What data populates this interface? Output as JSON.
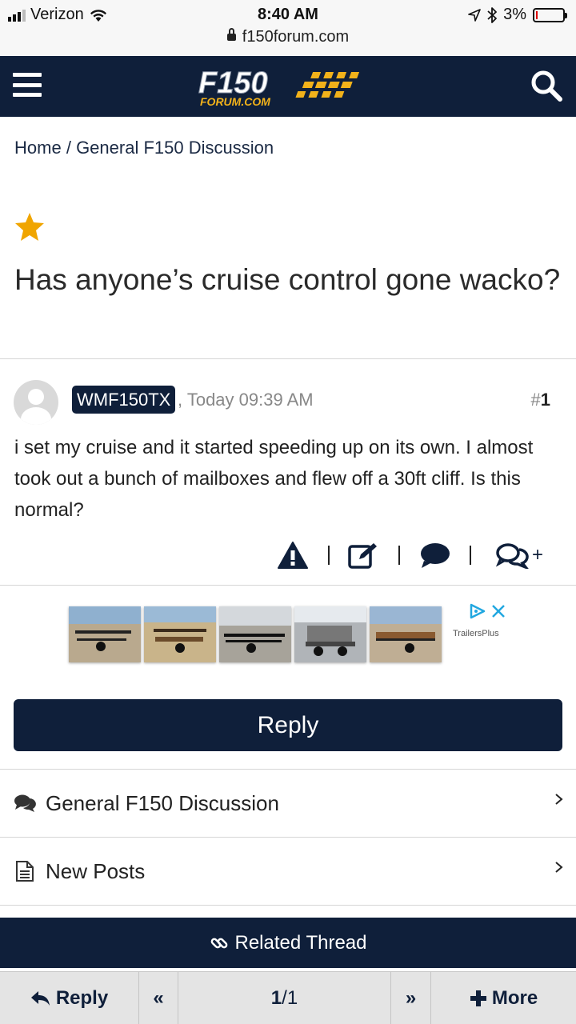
{
  "status_bar": {
    "carrier": "Verizon",
    "time": "8:40 AM",
    "battery": "3%",
    "url": "f150forum.com"
  },
  "header": {
    "logo_text": "F150",
    "logo_subtext": "FORUM.COM"
  },
  "breadcrumb": {
    "home": "Home",
    "separator": "/",
    "current": "General F150 Discussion"
  },
  "thread": {
    "title": "Has anyone’s cruise control gone wacko?"
  },
  "post": {
    "username": "WMF150TX",
    "time": ", Today 09:39 AM",
    "number_prefix": "#",
    "number": "1",
    "body": "i set my cruise and it started speeding up on its own. I almost took out a bunch of mailboxes and flew off a 30ft cliff. Is this normal?",
    "multiquote_plus": "+"
  },
  "ad": {
    "brand": "TrailersPlus"
  },
  "reply_button": "Reply",
  "links": {
    "forum": "General F150 Discussion",
    "new_posts": "New Posts"
  },
  "related": "Related Thread",
  "toolbar": {
    "reply": "Reply",
    "prev": "«",
    "page_current": "1",
    "page_sep": "/",
    "page_total": "1",
    "next": "»",
    "more": "More"
  },
  "colors": {
    "navy": "#0f1f3a",
    "star": "#f0a500",
    "logo_yellow": "#f2b21a"
  }
}
